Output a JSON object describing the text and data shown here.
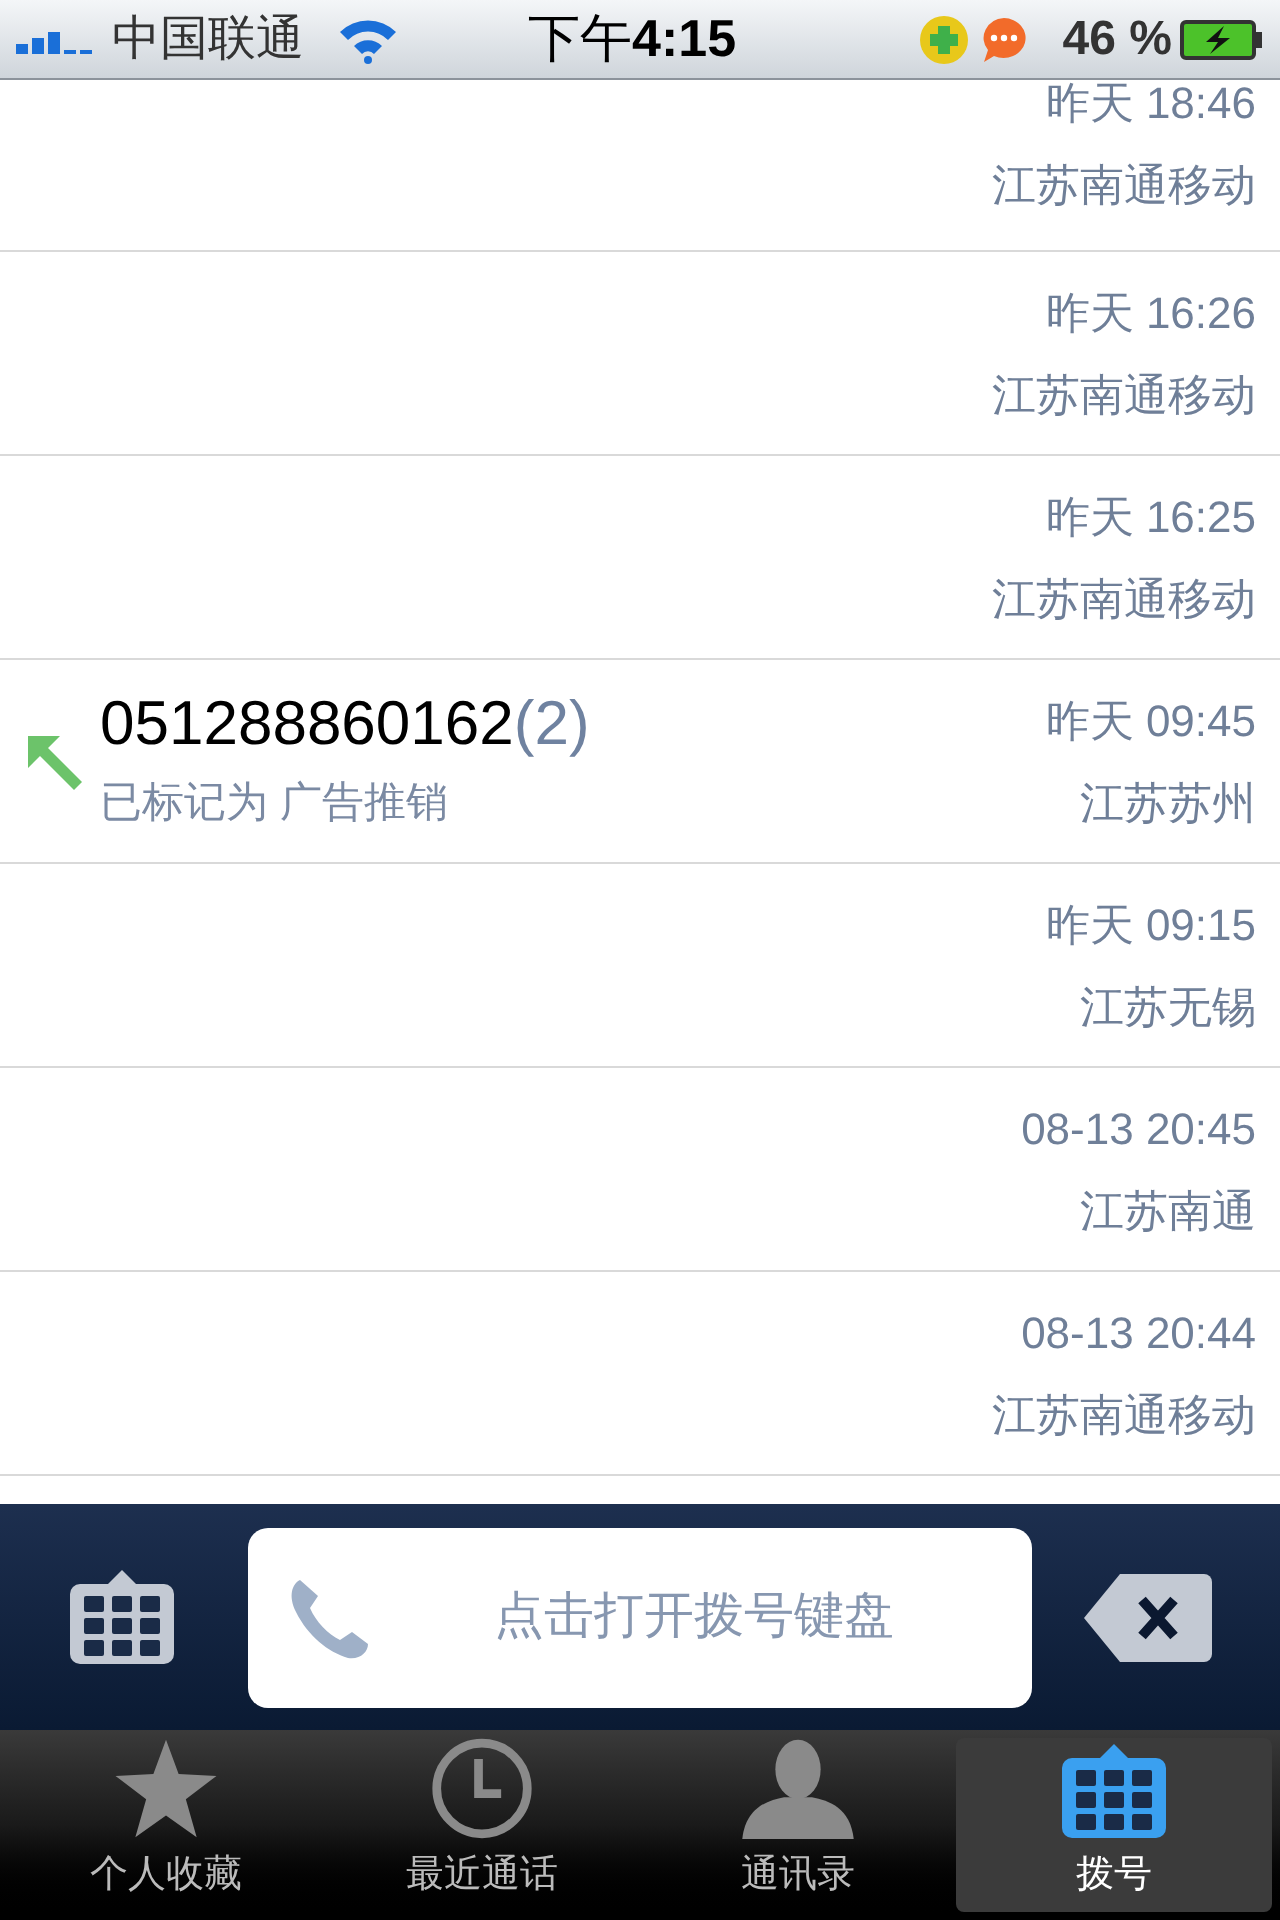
{
  "status_bar": {
    "carrier": "中国联通",
    "time_prefix": "下午",
    "time": "4:15",
    "battery": "46 %"
  },
  "calls": [
    {
      "time": "昨天 18:46",
      "location": "江苏南通移动"
    },
    {
      "time": "昨天 16:26",
      "location": "江苏南通移动"
    },
    {
      "time": "昨天 16:25",
      "location": "江苏南通移动"
    },
    {
      "number": "051288860162",
      "count": "(2)",
      "note": "已标记为 广告推销",
      "kind": "outgoing",
      "time": "昨天 09:45",
      "location": "江苏苏州"
    },
    {
      "time": "昨天 09:15",
      "location": "江苏无锡"
    },
    {
      "time": "08-13 20:45",
      "location": "江苏南通"
    },
    {
      "time": "08-13 20:44",
      "location": "江苏南通移动"
    }
  ],
  "dialer": {
    "placeholder": "点击打开拨号键盘"
  },
  "tabs": [
    {
      "label": "个人收藏",
      "kind": "star",
      "selected": false
    },
    {
      "label": "最近通话",
      "kind": "clock",
      "selected": false
    },
    {
      "label": "通讯录",
      "kind": "person",
      "selected": false
    },
    {
      "label": "拨号",
      "kind": "keypad",
      "selected": true
    }
  ]
}
